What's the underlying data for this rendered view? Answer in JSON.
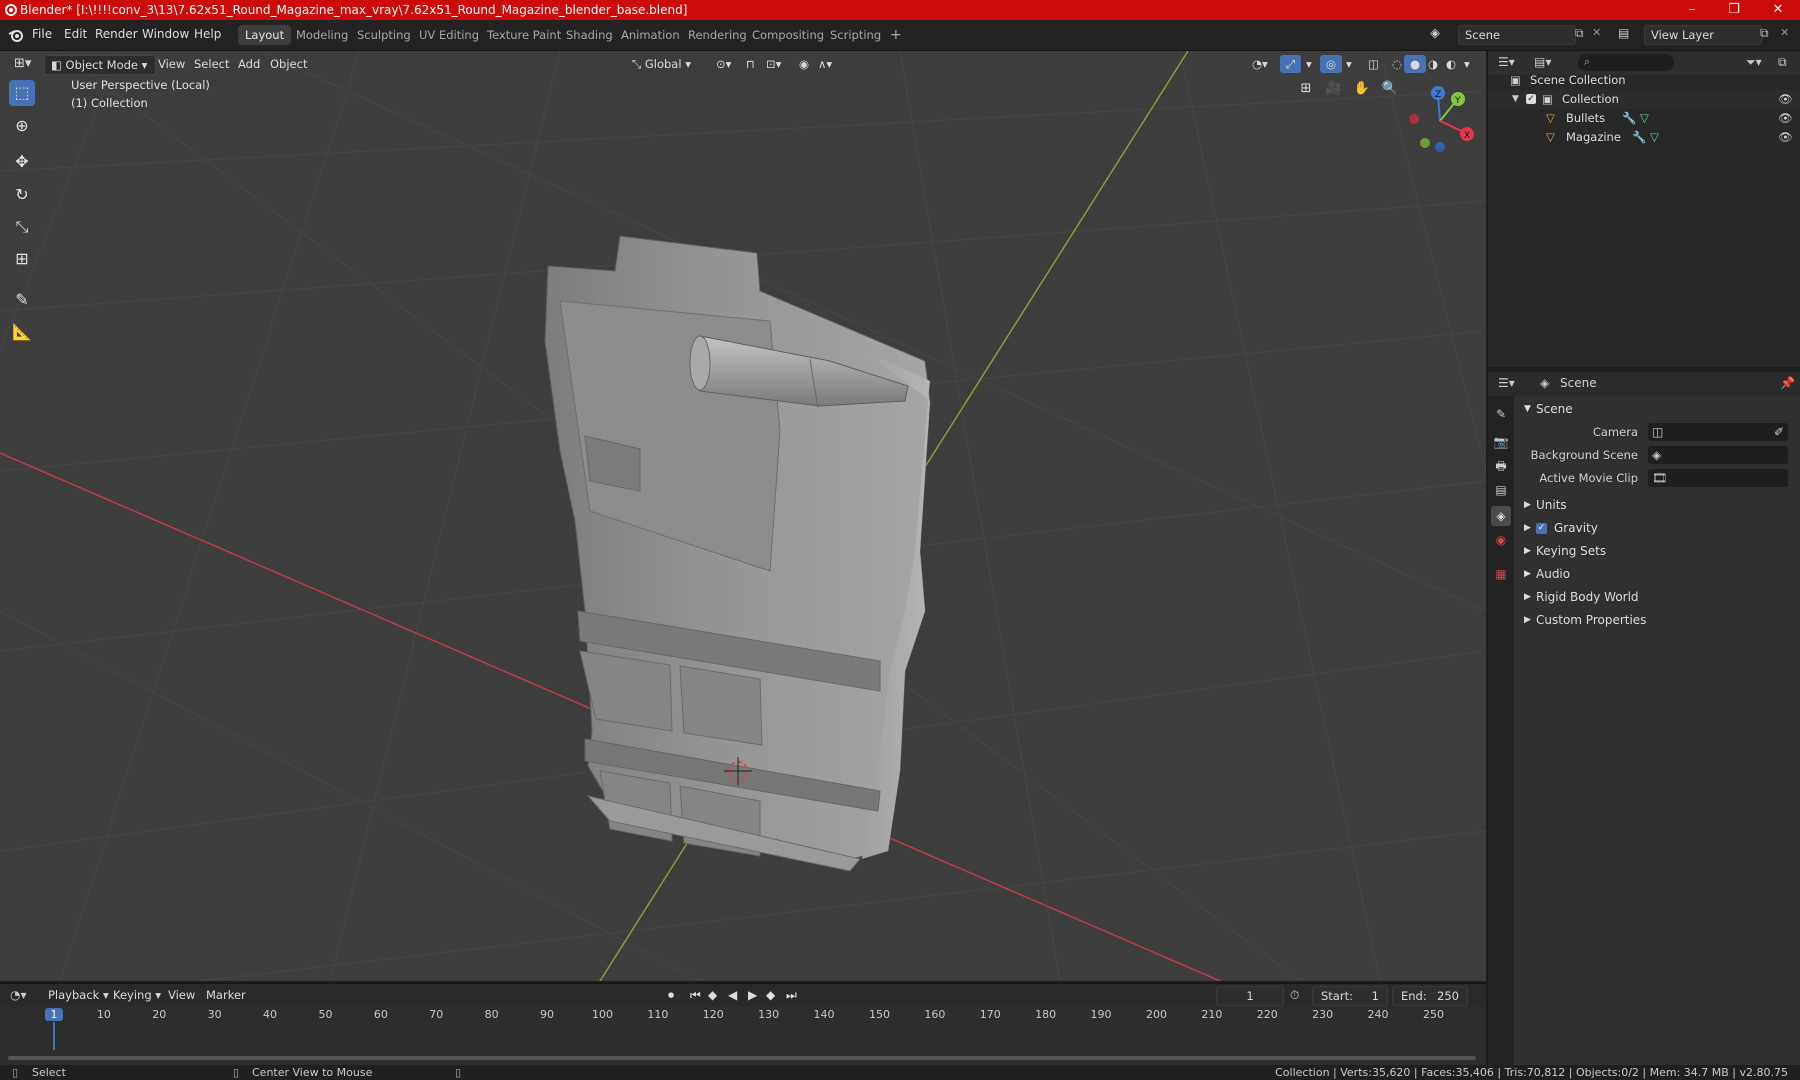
{
  "window": {
    "title": "Blender* [I:\\!!!!conv_3\\13\\7.62x51_Round_Magazine_max_vray\\7.62x51_Round_Magazine_blender_base.blend]",
    "minimize": "–",
    "maximize": "❐",
    "close": "✕"
  },
  "menu": [
    "File",
    "Edit",
    "Render",
    "Window",
    "Help"
  ],
  "workspaces": [
    "Layout",
    "Modeling",
    "Sculpting",
    "UV Editing",
    "Texture Paint",
    "Shading",
    "Animation",
    "Rendering",
    "Compositing",
    "Scripting"
  ],
  "active_workspace": "Layout",
  "add_workspace": "+",
  "scene_selector": {
    "value": "Scene"
  },
  "view_layer_selector": {
    "value": "View Layer"
  },
  "viewport": {
    "mode": "Object Mode",
    "menus": [
      "View",
      "Select",
      "Add",
      "Object"
    ],
    "orientation": "Global",
    "overlay_title": "User Perspective (Local)",
    "overlay_subtitle": "(1) Collection",
    "axes": {
      "z": "Z",
      "y": "Y",
      "x": "X"
    }
  },
  "outliner": {
    "root": "Scene Collection",
    "collection": "Collection",
    "objects": [
      "Bullets",
      "Magazine"
    ]
  },
  "properties": {
    "header": "Scene",
    "panel": "Scene",
    "fields": [
      {
        "label": "Camera"
      },
      {
        "label": "Background Scene"
      },
      {
        "label": "Active Movie Clip"
      }
    ],
    "sections": [
      "Units",
      "Gravity",
      "Keying Sets",
      "Audio",
      "Rigid Body World",
      "Custom Properties"
    ],
    "gravity_checked": true
  },
  "timeline": {
    "menus": [
      "Playback",
      "Keying",
      "View",
      "Marker"
    ],
    "current_frame": "1",
    "start_label": "Start:",
    "start": "1",
    "end_label": "End:",
    "end": "250",
    "ruler": [
      "1",
      "10",
      "20",
      "30",
      "40",
      "50",
      "60",
      "70",
      "80",
      "90",
      "100",
      "110",
      "120",
      "130",
      "140",
      "150",
      "160",
      "170",
      "180",
      "190",
      "200",
      "210",
      "220",
      "230",
      "240",
      "250"
    ]
  },
  "statusbar": {
    "left": "Select",
    "middle": "Center View to Mouse",
    "stats": "Collection | Verts:35,620 | Faces:35,406 | Tris:70,812 | Objects:0/2 | Mem: 34.7 MB | v2.80.75"
  },
  "colors": {
    "title_bar": "#cc0a0a",
    "accent": "#4772b3",
    "x_axis": "#e8344e",
    "y_axis": "#8ac43f",
    "z_axis": "#3b7cd9",
    "mesh": "#8e8e8e"
  }
}
